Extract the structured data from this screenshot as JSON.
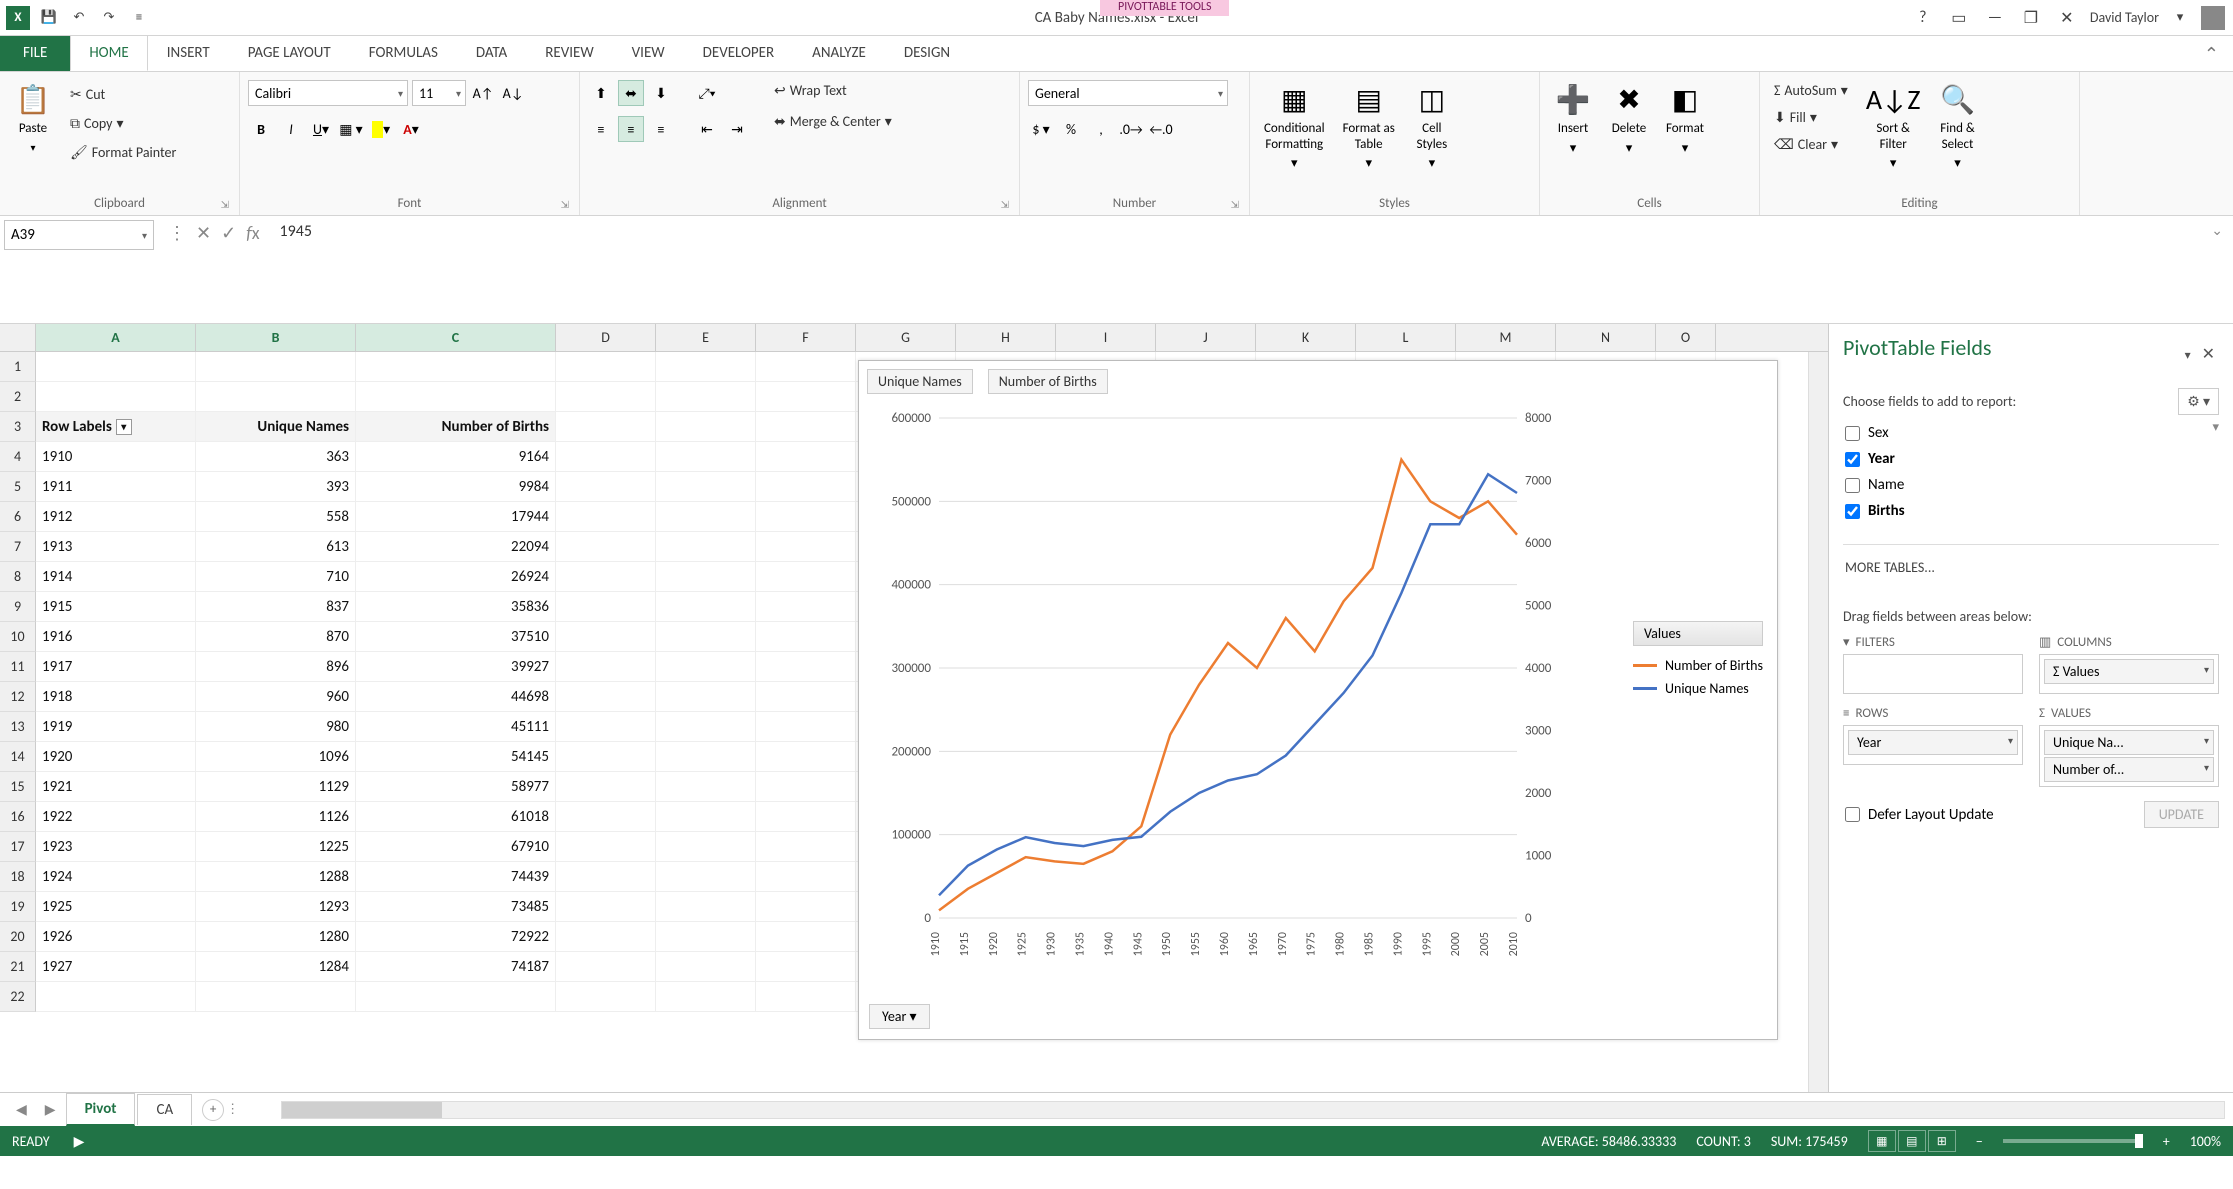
{
  "title": "CA Baby Names.xlsx - Excel",
  "tool_context": "PIVOTTABLE TOOLS",
  "user": "David Taylor",
  "tabs": {
    "file": "FILE",
    "home": "HOME",
    "insert": "INSERT",
    "page_layout": "PAGE LAYOUT",
    "formulas": "FORMULAS",
    "data": "DATA",
    "review": "REVIEW",
    "view": "VIEW",
    "developer": "DEVELOPER",
    "analyze": "ANALYZE",
    "design": "DESIGN"
  },
  "ribbon": {
    "clipboard": {
      "label": "Clipboard",
      "paste": "Paste",
      "cut": "Cut",
      "copy": "Copy",
      "format_painter": "Format Painter"
    },
    "font": {
      "label": "Font",
      "name": "Calibri",
      "size": "11"
    },
    "alignment": {
      "label": "Alignment",
      "wrap": "Wrap Text",
      "merge": "Merge & Center"
    },
    "number": {
      "label": "Number",
      "format": "General"
    },
    "styles": {
      "label": "Styles",
      "cond": "Conditional\nFormatting",
      "table": "Format as\nTable",
      "cell": "Cell\nStyles"
    },
    "cells": {
      "label": "Cells",
      "insert": "Insert",
      "delete": "Delete",
      "format": "Format"
    },
    "editing": {
      "label": "Editing",
      "autosum": "AutoSum",
      "fill": "Fill",
      "clear": "Clear",
      "sort": "Sort &\nFilter",
      "find": "Find &\nSelect"
    }
  },
  "namebox": "A39",
  "formula_value": "1945",
  "columns": [
    "A",
    "B",
    "C",
    "D",
    "E",
    "F",
    "G",
    "H",
    "I",
    "J",
    "K",
    "L",
    "M",
    "N",
    "O"
  ],
  "header_row": {
    "a": "Row Labels",
    "b": "Unique Names",
    "c": "Number of Births"
  },
  "rows": [
    {
      "n": 4,
      "y": "1910",
      "u": "363",
      "b": "9164"
    },
    {
      "n": 5,
      "y": "1911",
      "u": "393",
      "b": "9984"
    },
    {
      "n": 6,
      "y": "1912",
      "u": "558",
      "b": "17944"
    },
    {
      "n": 7,
      "y": "1913",
      "u": "613",
      "b": "22094"
    },
    {
      "n": 8,
      "y": "1914",
      "u": "710",
      "b": "26924"
    },
    {
      "n": 9,
      "y": "1915",
      "u": "837",
      "b": "35836"
    },
    {
      "n": 10,
      "y": "1916",
      "u": "870",
      "b": "37510"
    },
    {
      "n": 11,
      "y": "1917",
      "u": "896",
      "b": "39927"
    },
    {
      "n": 12,
      "y": "1918",
      "u": "960",
      "b": "44698"
    },
    {
      "n": 13,
      "y": "1919",
      "u": "980",
      "b": "45111"
    },
    {
      "n": 14,
      "y": "1920",
      "u": "1096",
      "b": "54145"
    },
    {
      "n": 15,
      "y": "1921",
      "u": "1129",
      "b": "58977"
    },
    {
      "n": 16,
      "y": "1922",
      "u": "1126",
      "b": "61018"
    },
    {
      "n": 17,
      "y": "1923",
      "u": "1225",
      "b": "67910"
    },
    {
      "n": 18,
      "y": "1924",
      "u": "1288",
      "b": "74439"
    },
    {
      "n": 19,
      "y": "1925",
      "u": "1293",
      "b": "73485"
    },
    {
      "n": 20,
      "y": "1926",
      "u": "1280",
      "b": "72922"
    },
    {
      "n": 21,
      "y": "1927",
      "u": "1284",
      "b": "74187"
    }
  ],
  "chart_data": {
    "type": "line",
    "field_buttons": [
      "Unique Names",
      "Number of Births"
    ],
    "axis_filter": "Year",
    "legend_title": "Values",
    "x": [
      1910,
      1915,
      1920,
      1925,
      1930,
      1935,
      1940,
      1945,
      1950,
      1955,
      1960,
      1965,
      1970,
      1975,
      1980,
      1985,
      1990,
      1995,
      2000,
      2005,
      2010
    ],
    "yL": {
      "label": "Number of Births",
      "ticks": [
        0,
        100000,
        200000,
        300000,
        400000,
        500000,
        600000
      ],
      "max": 600000
    },
    "yR": {
      "label": "Unique Names",
      "ticks": [
        0,
        1000,
        2000,
        3000,
        4000,
        5000,
        6000,
        7000,
        8000
      ],
      "max": 8000
    },
    "series": [
      {
        "name": "Number of Births",
        "color": "#ed7d31",
        "axis": "L",
        "values": [
          9164,
          35000,
          54000,
          73000,
          68000,
          65000,
          80000,
          110000,
          220000,
          280000,
          330000,
          300000,
          360000,
          320000,
          380000,
          420000,
          550000,
          500000,
          480000,
          500000,
          460000
        ]
      },
      {
        "name": "Unique Names",
        "color": "#4472c4",
        "axis": "R",
        "values": [
          363,
          837,
          1096,
          1293,
          1200,
          1150,
          1250,
          1300,
          1700,
          2000,
          2200,
          2300,
          2600,
          3100,
          3600,
          4200,
          5200,
          6300,
          6300,
          7100,
          6800
        ]
      }
    ]
  },
  "pivot_pane": {
    "title": "PivotTable Fields",
    "choose": "Choose fields to add to report:",
    "fields": [
      {
        "label": "Sex",
        "checked": false
      },
      {
        "label": "Year",
        "checked": true
      },
      {
        "label": "Name",
        "checked": false
      },
      {
        "label": "Births",
        "checked": true
      }
    ],
    "more": "MORE TABLES...",
    "drag": "Drag fields between areas below:",
    "areas": {
      "filters": {
        "title": "FILTERS",
        "items": []
      },
      "columns": {
        "title": "COLUMNS",
        "items": [
          "Σ Values"
        ]
      },
      "rows": {
        "title": "ROWS",
        "items": [
          "Year"
        ]
      },
      "values": {
        "title": "VALUES",
        "items": [
          "Unique Na...",
          "Number of..."
        ]
      }
    },
    "defer": "Defer Layout Update",
    "update": "UPDATE"
  },
  "sheet_tabs": {
    "active": "Pivot",
    "other": "CA"
  },
  "statusbar": {
    "ready": "READY",
    "avg": "AVERAGE: 58486.33333",
    "count": "COUNT: 3",
    "sum": "SUM: 175459",
    "zoom": "100%"
  }
}
